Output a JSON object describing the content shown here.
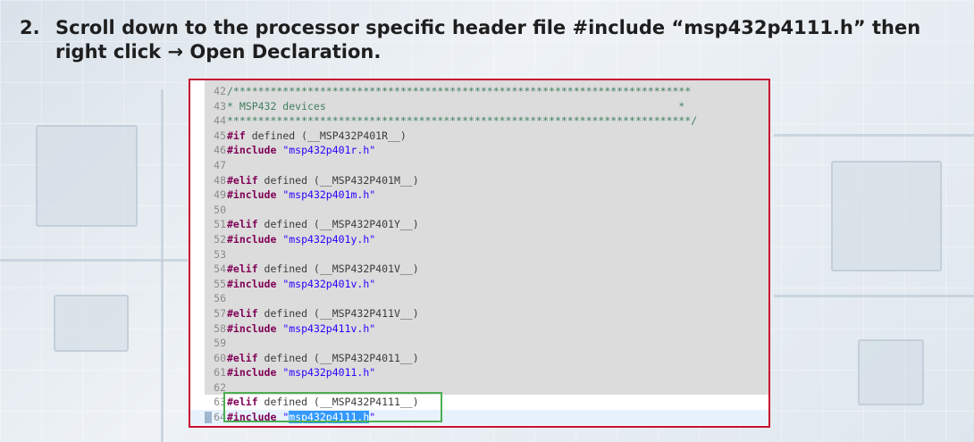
{
  "instruction": {
    "number": "2.",
    "text": "Scroll down to the processor specific header file #include “msp432p4111.h” then right click → Open Declaration."
  },
  "editor": {
    "lines": [
      {
        "n": "42",
        "parts": [
          {
            "t": "/**************************************************************************",
            "c": "comment"
          }
        ]
      },
      {
        "n": "43",
        "parts": [
          {
            "t": "* MSP432 devices                                                         *",
            "c": "comment"
          }
        ]
      },
      {
        "n": "44",
        "parts": [
          {
            "t": "***************************************************************************/",
            "c": "comment"
          }
        ]
      },
      {
        "n": "45",
        "parts": [
          {
            "t": "#if",
            "c": "kw"
          },
          {
            "t": " defined (__MSP432P401R__)",
            "c": "plain"
          }
        ]
      },
      {
        "n": "46",
        "parts": [
          {
            "t": "#include",
            "c": "kw"
          },
          {
            "t": " ",
            "c": "plain"
          },
          {
            "t": "\"msp432p401r.h\"",
            "c": "str"
          }
        ]
      },
      {
        "n": "47",
        "parts": []
      },
      {
        "n": "48",
        "parts": [
          {
            "t": "#elif",
            "c": "kw"
          },
          {
            "t": " defined (__MSP432P401M__)",
            "c": "plain"
          }
        ]
      },
      {
        "n": "49",
        "parts": [
          {
            "t": "#include",
            "c": "kw"
          },
          {
            "t": " ",
            "c": "plain"
          },
          {
            "t": "\"msp432p401m.h\"",
            "c": "str"
          }
        ]
      },
      {
        "n": "50",
        "parts": []
      },
      {
        "n": "51",
        "parts": [
          {
            "t": "#elif",
            "c": "kw"
          },
          {
            "t": " defined (__MSP432P401Y__)",
            "c": "plain"
          }
        ]
      },
      {
        "n": "52",
        "parts": [
          {
            "t": "#include",
            "c": "kw"
          },
          {
            "t": " ",
            "c": "plain"
          },
          {
            "t": "\"msp432p401y.h\"",
            "c": "str"
          }
        ]
      },
      {
        "n": "53",
        "parts": []
      },
      {
        "n": "54",
        "parts": [
          {
            "t": "#elif",
            "c": "kw"
          },
          {
            "t": " defined (__MSP432P401V__)",
            "c": "plain"
          }
        ]
      },
      {
        "n": "55",
        "parts": [
          {
            "t": "#include",
            "c": "kw"
          },
          {
            "t": " ",
            "c": "plain"
          },
          {
            "t": "\"msp432p401v.h\"",
            "c": "str"
          }
        ]
      },
      {
        "n": "56",
        "parts": []
      },
      {
        "n": "57",
        "parts": [
          {
            "t": "#elif",
            "c": "kw"
          },
          {
            "t": " defined (__MSP432P411V__)",
            "c": "plain"
          }
        ]
      },
      {
        "n": "58",
        "parts": [
          {
            "t": "#include",
            "c": "kw"
          },
          {
            "t": " ",
            "c": "plain"
          },
          {
            "t": "\"msp432p411v.h\"",
            "c": "str"
          }
        ]
      },
      {
        "n": "59",
        "parts": []
      },
      {
        "n": "60",
        "parts": [
          {
            "t": "#elif",
            "c": "kw"
          },
          {
            "t": " defined (__MSP432P4011__)",
            "c": "plain"
          }
        ]
      },
      {
        "n": "61",
        "parts": [
          {
            "t": "#include",
            "c": "kw"
          },
          {
            "t": " ",
            "c": "plain"
          },
          {
            "t": "\"msp432p4011.h\"",
            "c": "str"
          }
        ]
      },
      {
        "n": "62",
        "parts": []
      },
      {
        "n": "63",
        "parts": [
          {
            "t": "#elif",
            "c": "kw"
          },
          {
            "t": " defined (__MSP432P4111__)",
            "c": "plain"
          }
        ]
      },
      {
        "n": "64",
        "current": true,
        "parts": [
          {
            "t": "#include",
            "c": "kw"
          },
          {
            "t": " ",
            "c": "plain"
          },
          {
            "t": "\"",
            "c": "str"
          },
          {
            "t": "msp432p4111.h",
            "c": "sel"
          },
          {
            "t": "\"",
            "c": "str"
          }
        ]
      }
    ]
  },
  "colors": {
    "highlight_border": "#c8102e",
    "focus_box": "#4caf50",
    "selection": "#3399ff"
  }
}
